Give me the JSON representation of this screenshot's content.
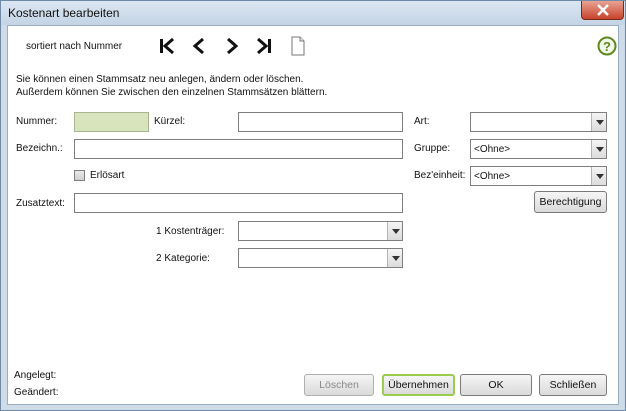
{
  "window": {
    "title": "Kostenart bearbeiten"
  },
  "toolbar": {
    "sort_label": "sortiert nach Nummer"
  },
  "info": {
    "line1": "Sie können einen Stammsatz neu anlegen, ändern oder löschen.",
    "line2": "Außerdem können Sie zwischen den einzelnen Stammsätzen blättern."
  },
  "form": {
    "nummer_label": "Nummer:",
    "nummer_value": "",
    "kuerzel_label": "Kürzel:",
    "kuerzel_value": "",
    "bezeichn_label": "Bezeichn.:",
    "bezeichn_value": "",
    "erloesart_label": "Erlösart",
    "zusatztext_label": "Zusatztext:",
    "zusatztext_value": "",
    "kostentraeger_label": "1 Kostenträger:",
    "kostentraeger_value": "",
    "kategorie_label": "2 Kategorie:",
    "kategorie_value": "",
    "art_label": "Art:",
    "art_value": "",
    "gruppe_label": "Gruppe:",
    "gruppe_value": "<Ohne>",
    "bezeinheit_label": "Bez'einheit:",
    "bezeinheit_value": "<Ohne>"
  },
  "buttons": {
    "berechtigung": "Berechtigung",
    "loeschen": "Löschen",
    "uebernehmen": "Übernehmen",
    "ok": "OK",
    "schliessen": "Schließen"
  },
  "footer": {
    "angelegt_label": "Angelegt:",
    "geaendert_label": "Geändert:"
  },
  "icons": {
    "first": "first-record-icon",
    "prev": "previous-record-icon",
    "next": "next-record-icon",
    "last": "last-record-icon",
    "new": "new-document-icon",
    "help": "help-icon",
    "close": "close-icon"
  },
  "colors": {
    "help_green": "#5b8a1e",
    "highlight_border": "#9ccc4d",
    "nummer_bg": "#d7e4bc"
  }
}
